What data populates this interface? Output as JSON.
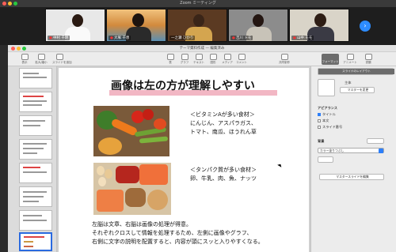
{
  "zoom": {
    "title": "Zoom ミーティング",
    "participants": [
      {
        "name": "中村 千明"
      },
      {
        "name": "大塚 千恵"
      },
      {
        "name": "一之瀬 ひかり"
      },
      {
        "name": "吉川 トモ"
      },
      {
        "name": "山中 モモ"
      }
    ],
    "next_icon": "chevron-right-icon",
    "next_glyph": "›"
  },
  "keynote": {
    "window_title": "テーマ資料作成 — 編集済み",
    "toolbar_left": [
      {
        "label": "表示",
        "icon": "view-icon"
      },
      {
        "label": "拡大/縮小",
        "icon": "zoom-icon"
      },
      {
        "label": "スライドを追加",
        "icon": "add-slide-icon"
      }
    ],
    "toolbar_center": [
      {
        "label": "表",
        "icon": "table-icon"
      },
      {
        "label": "グラフ",
        "icon": "chart-icon"
      },
      {
        "label": "テキスト",
        "icon": "text-icon"
      },
      {
        "label": "図形",
        "icon": "shape-icon"
      },
      {
        "label": "メディア",
        "icon": "media-icon"
      },
      {
        "label": "コメント",
        "icon": "comment-icon"
      }
    ],
    "toolbar_right": [
      {
        "label": "共同制作",
        "icon": "collaborate-icon"
      }
    ],
    "toolbar_far_right": [
      {
        "label": "フォーマット",
        "icon": "format-icon"
      },
      {
        "label": "アニメート",
        "icon": "animate-icon"
      },
      {
        "label": "書類",
        "icon": "document-icon"
      }
    ]
  },
  "slide": {
    "title": "画像は左の方が理解しやすい",
    "caption1_line1": "＜ビタミンAが多い食材＞",
    "caption1_line2": "にんじん、アスパラガス、",
    "caption1_line3": "トマト、南瓜、ほうれん草",
    "caption2_line1": "＜タンパク質が多い食材＞",
    "caption2_line2": "卵、牛乳、肉、魚、ナッツ",
    "body_line1": "左脳は文章、右脳は画像の処理が得意。",
    "body_line2": "それぞれクロスして情報を処理するため、左側に画像やグラフ、",
    "body_line3": "右側に文字の説明を配置すると、内容が頭にスッと入りやすくなる。"
  },
  "inspector": {
    "tabs": [
      "スライドのレイアウト",
      "",
      ""
    ],
    "layout_label": "主体",
    "change_master_button": "マスターを変更",
    "appearance_header": "アピアランス",
    "opt_title": "タイトル",
    "opt_body": "本文",
    "opt_slide_number": "スライド番号",
    "bg_header": "背景",
    "bg_select": "カラー塗りつぶし",
    "edit_master_button": "マスタースライドを編集"
  },
  "colors": {
    "zoom_accent": "#2d8cff",
    "title_highlight": "#f2b7c4",
    "selection": "#2a6ae0"
  }
}
